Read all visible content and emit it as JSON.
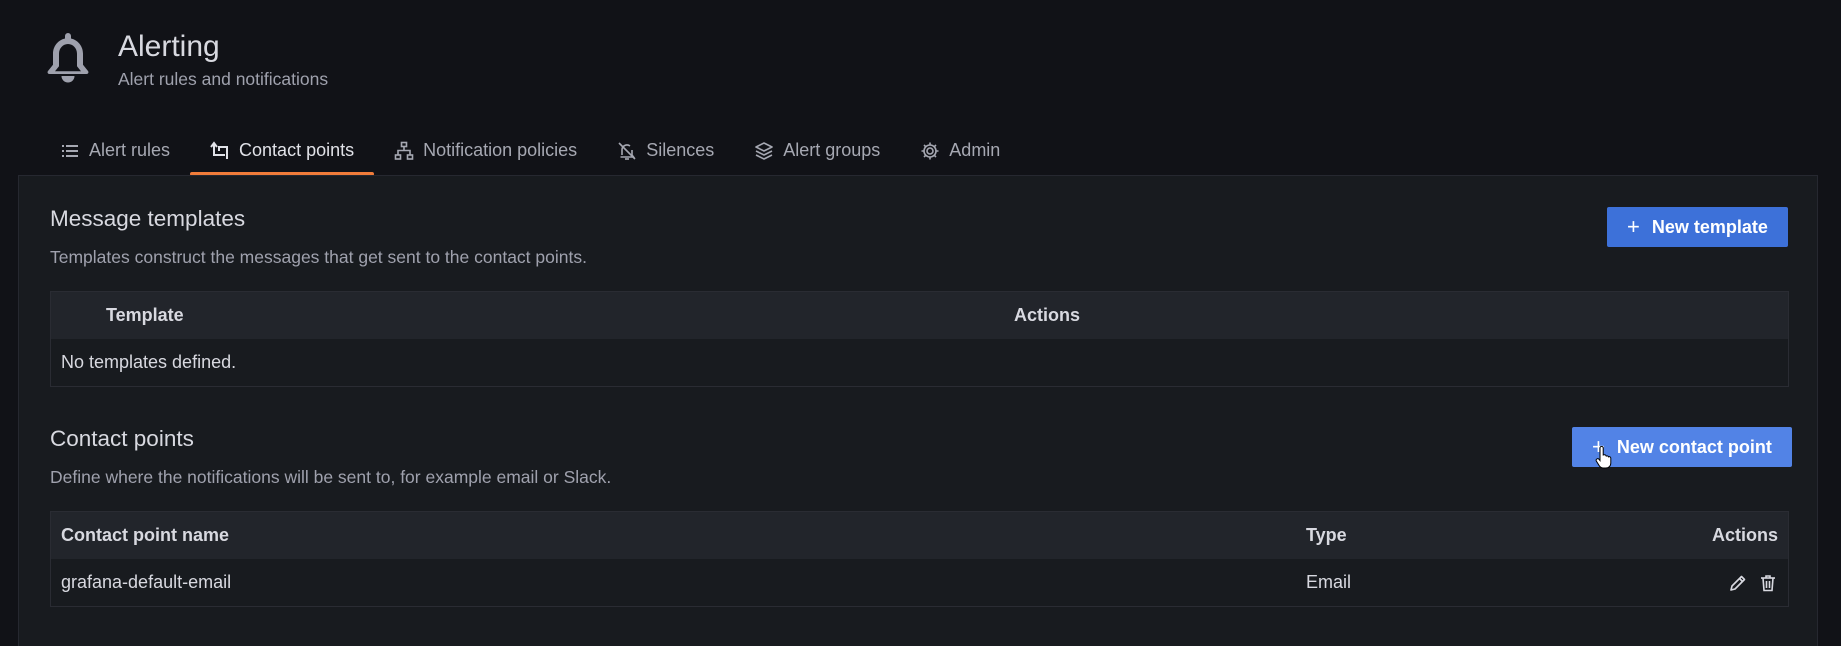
{
  "page": {
    "title": "Alerting",
    "subtitle": "Alert rules and notifications",
    "icon": "bell-icon"
  },
  "tabs": [
    {
      "label": "Alert rules",
      "icon": "list-icon",
      "active": false
    },
    {
      "label": "Contact points",
      "icon": "contact-point-icon",
      "active": true
    },
    {
      "label": "Notification policies",
      "icon": "sitemap-icon",
      "active": false
    },
    {
      "label": "Silences",
      "icon": "bell-slash-icon",
      "active": false
    },
    {
      "label": "Alert groups",
      "icon": "layers-icon",
      "active": false
    },
    {
      "label": "Admin",
      "icon": "gear-icon",
      "active": false
    }
  ],
  "templates": {
    "title": "Message templates",
    "description": "Templates construct the messages that get sent to the contact points.",
    "button": "New template",
    "columns": {
      "template": "Template",
      "actions": "Actions"
    },
    "empty": "No templates defined."
  },
  "contact_points": {
    "title": "Contact points",
    "description": "Define where the notifications will be sent to, for example email or Slack.",
    "button": "New contact point",
    "columns": {
      "name": "Contact point name",
      "type": "Type",
      "actions": "Actions"
    },
    "rows": [
      {
        "name": "grafana-default-email",
        "type": "Email"
      }
    ]
  },
  "colors": {
    "background": "#111217",
    "panel": "#181b1f",
    "primary_button": "#3d71d9",
    "active_tab_underline": "#f07c3a"
  }
}
